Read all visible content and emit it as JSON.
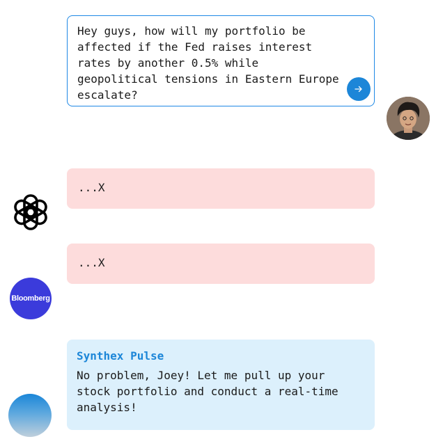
{
  "user_message": {
    "text": "Hey guys, how will my portfolio be affected if the Fed raises interest rates by another 0.5% while geopolitical tensions in Eastern Europe escalate?",
    "send_icon": "arrow-right-icon"
  },
  "user_avatar": {
    "icon": "user-photo"
  },
  "responses": [
    {
      "source_icon": "openai-logo-icon",
      "text": "...X",
      "status_color": "#fddcdc"
    },
    {
      "source_label": "Bloomberg",
      "text": "...X",
      "status_color": "#fddcdc"
    }
  ],
  "answer": {
    "name": "Synthex Pulse",
    "text": "No problem, Joey! Let me pull up your stock portfolio and conduct a real-time analysis!",
    "accent": "#1c86d8",
    "bubble_color": "#dcf0fc"
  }
}
